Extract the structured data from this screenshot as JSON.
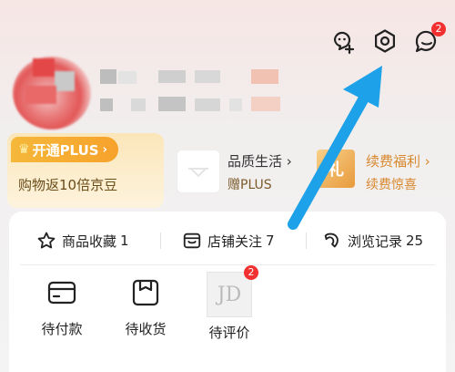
{
  "top_icons": [
    {
      "name": "add-friend-icon"
    },
    {
      "name": "settings-icon"
    },
    {
      "name": "message-icon",
      "badge": "2"
    }
  ],
  "plus": {
    "tag_label": "开通PLUS",
    "tag_chevron": "›",
    "subtitle": "购物返10倍京豆"
  },
  "quality": {
    "title": "品质生活",
    "chevron": "›",
    "subtitle": "赠PLUS"
  },
  "gift": {
    "box_label": "礼",
    "title": "续费福利",
    "chevron": "›",
    "subtitle": "续费惊喜"
  },
  "stats": [
    {
      "label": "商品收藏",
      "count": "1"
    },
    {
      "label": "店铺关注",
      "count": "7"
    },
    {
      "label": "浏览记录",
      "count": "25"
    }
  ],
  "orders": [
    {
      "label": "待付款"
    },
    {
      "label": "待收货"
    },
    {
      "label": "待评价",
      "badge": "2",
      "thumb_text": "JD"
    }
  ],
  "colors": {
    "accent_red": "#f23030",
    "plus_gold": "#f6a22b",
    "arrow_blue": "#1da1e8"
  }
}
